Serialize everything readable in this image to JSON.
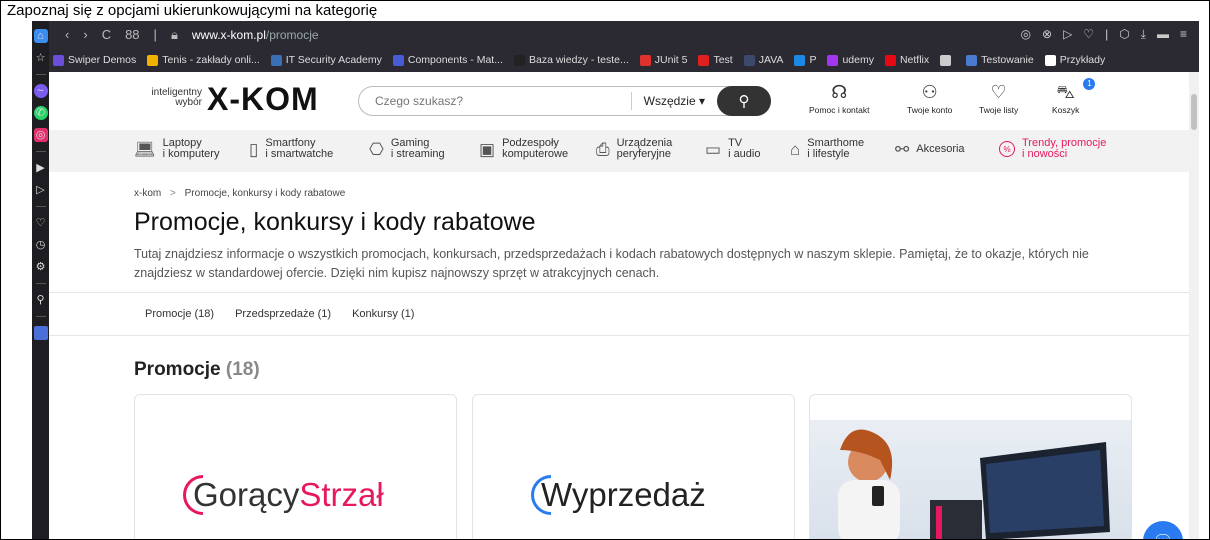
{
  "caption": "Zapoznaj się z opcjami ukierunkowującymi na kategorię",
  "browser": {
    "url_host": "www.x-kom.pl",
    "url_path": "/promocje",
    "speed_dial_label": "88",
    "bookmarks": [
      {
        "label": "Swiper Demos",
        "color": "#6b4fd9"
      },
      {
        "label": "Tenis - zakłady onli...",
        "color": "#f0b400"
      },
      {
        "label": "IT Security Academy",
        "color": "#3b6fb3"
      },
      {
        "label": "Components - Mat...",
        "color": "#4a5bd6"
      },
      {
        "label": "Baza wiedzy - teste...",
        "color": "#222222"
      },
      {
        "label": "JUnit 5",
        "color": "#e0322c"
      },
      {
        "label": "Test",
        "color": "#e02020"
      },
      {
        "label": "JAVA",
        "color": "#3b4a6a"
      },
      {
        "label": "P",
        "color": "#1e88e5"
      },
      {
        "label": "udemy",
        "color": "#a435f0"
      },
      {
        "label": "Netflix",
        "color": "#e50914"
      },
      {
        "label": "",
        "color": "#cccccc"
      },
      {
        "label": "Testowanie",
        "color": "#4a7bd0"
      },
      {
        "label": "Przykłady",
        "color": "#ffffff"
      }
    ]
  },
  "header": {
    "logo_tagline": "inteligentny wybór",
    "logo": "X-KOM",
    "search_placeholder": "Czego szukasz?",
    "search_scope": "Wszędzie ▾",
    "help": "Pomoc i kontakt",
    "account": "Twoje konto",
    "lists": "Twoje listy",
    "cart": "Koszyk",
    "cart_count": "1"
  },
  "categories": [
    {
      "line1": "Laptopy",
      "line2": "i komputery",
      "icon": "laptop-icon"
    },
    {
      "line1": "Smartfony",
      "line2": "i smartwatche",
      "icon": "phone-icon"
    },
    {
      "line1": "Gaming",
      "line2": "i streaming",
      "icon": "gamepad-icon"
    },
    {
      "line1": "Podzespoły",
      "line2": "komputerowe",
      "icon": "chip-icon"
    },
    {
      "line1": "Urządzenia",
      "line2": "peryferyjne",
      "icon": "printer-icon"
    },
    {
      "line1": "TV",
      "line2": "i audio",
      "icon": "tv-icon"
    },
    {
      "line1": "Smarthome",
      "line2": "i lifestyle",
      "icon": "home-icon"
    },
    {
      "line1": "Akcesoria",
      "line2": "",
      "icon": "accessories-icon"
    },
    {
      "line1": "Trendy, promocje",
      "line2": "i nowości",
      "icon": "percent-icon"
    }
  ],
  "breadcrumb": {
    "root": "x-kom",
    "sep": ">",
    "current": "Promocje, konkursy i kody rabatowe"
  },
  "page": {
    "title": "Promocje, konkursy i kody rabatowe",
    "intro": "Tutaj znajdziesz informacje o wszystkich promocjach, konkursach, przedsprzedażach i kodach rabatowych dostępnych w naszym sklepie. Pamiętaj, że to okazje, których nie znajdziesz w standardowej ofercie. Dzięki nim kupisz najnowszy sprzęt w atrakcyjnych cenach."
  },
  "tabs": [
    "Promocje (18)",
    "Przedsprzedaże (1)",
    "Konkursy (1)"
  ],
  "section": {
    "title": "Promocje",
    "count": "(18)"
  },
  "cards": [
    {
      "brand_part1": "Gorący",
      "brand_part2": "Strzał"
    },
    {
      "brand_part1": "Wyprzedaż",
      "brand_part2": ""
    }
  ]
}
